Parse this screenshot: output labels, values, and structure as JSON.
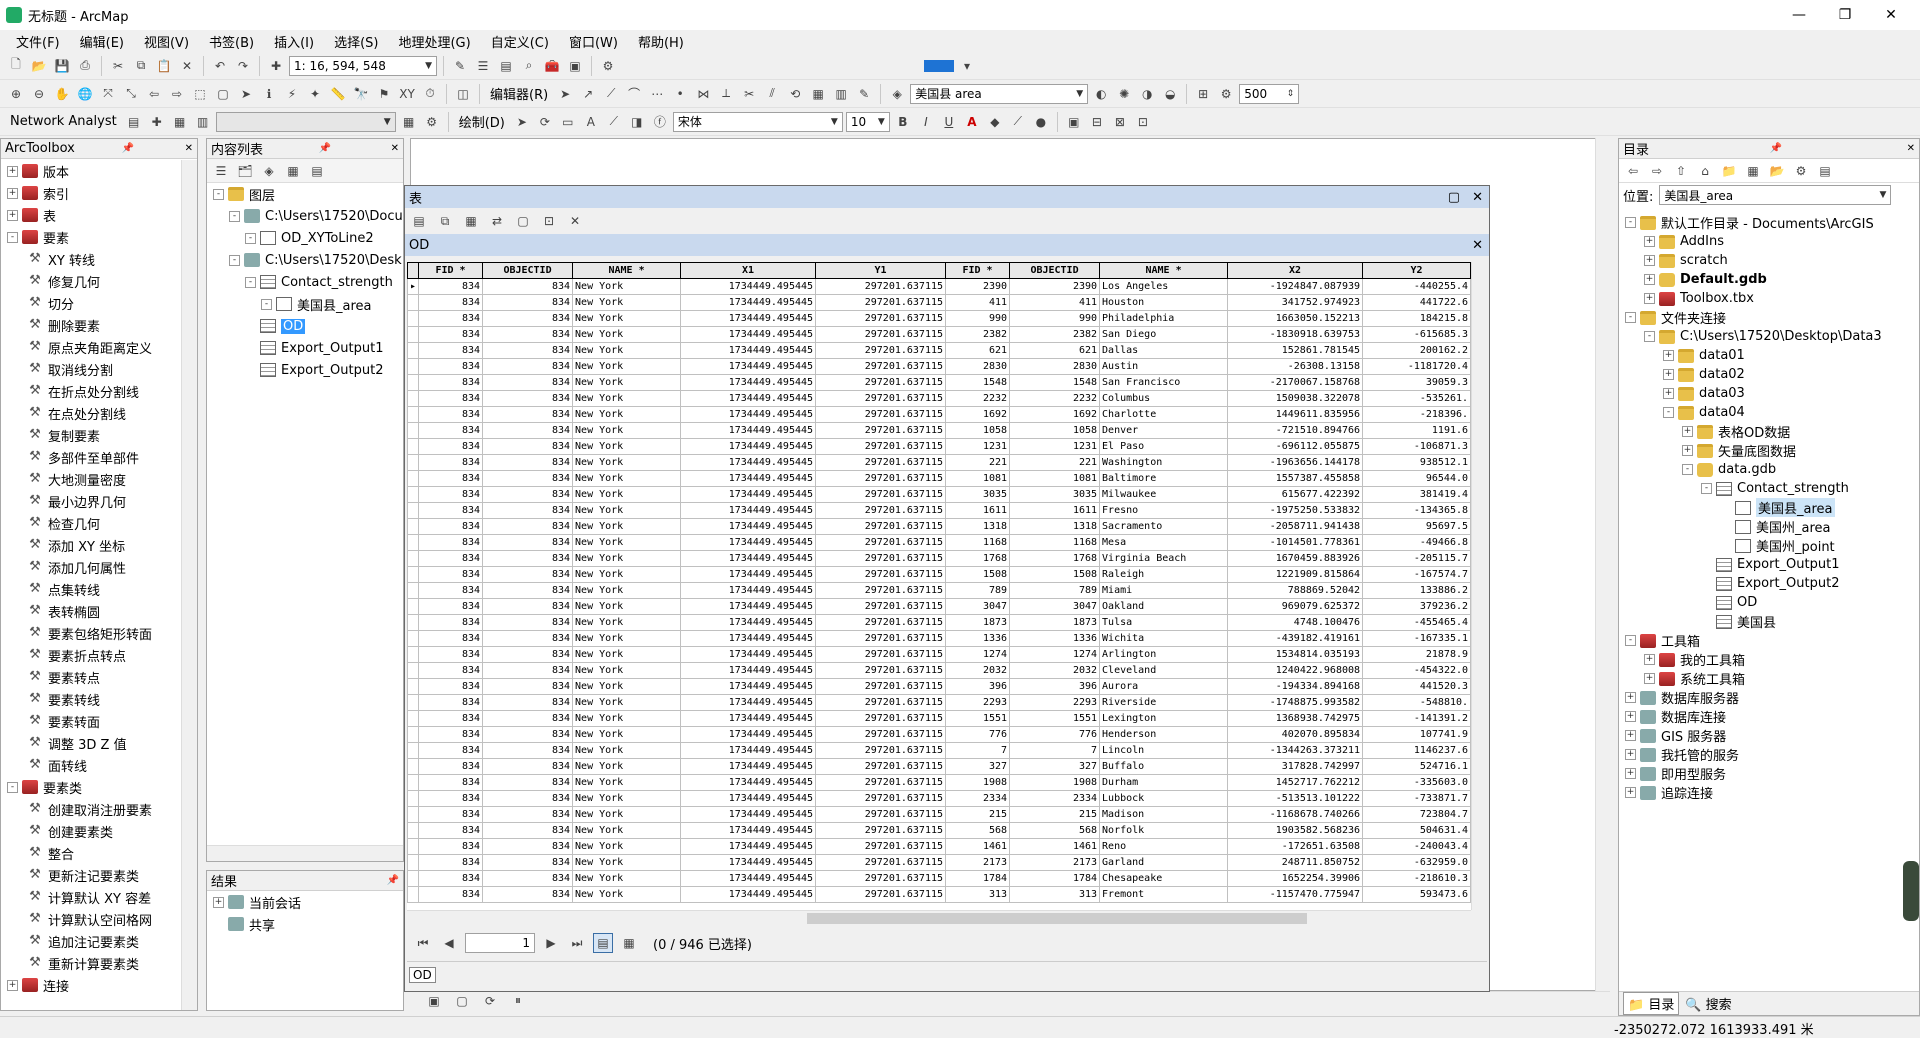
{
  "window": {
    "title": "无标题 - ArcMap"
  },
  "menu": [
    "文件(F)",
    "编辑(E)",
    "视图(V)",
    "书签(B)",
    "插入(I)",
    "选择(S)",
    "地理处理(G)",
    "自定义(C)",
    "窗口(W)",
    "帮助(H)"
  ],
  "toolbar": {
    "scale": "1: 16, 594, 548",
    "layer_select": "美国县 area",
    "editor_label": "编辑器(R)",
    "number_value": "500",
    "network_analyst": "Network Analyst",
    "draw_label": "绘制(D)",
    "font_name": "宋体",
    "font_size": "10",
    "bold": "B",
    "italic": "I",
    "underline": "U",
    "font_color": "A"
  },
  "arctoolbox": {
    "title": "ArcToolbox",
    "items": [
      {
        "label": "版本",
        "kind": "box",
        "expanded": false,
        "level": 0
      },
      {
        "label": "索引",
        "kind": "box",
        "expanded": false,
        "level": 0
      },
      {
        "label": "表",
        "kind": "box",
        "expanded": false,
        "level": 0
      },
      {
        "label": "要素",
        "kind": "box",
        "expanded": true,
        "level": 0
      },
      {
        "label": "XY 转线",
        "kind": "tool",
        "level": 1
      },
      {
        "label": "修复几何",
        "kind": "tool",
        "level": 1
      },
      {
        "label": "切分",
        "kind": "tool",
        "level": 1
      },
      {
        "label": "删除要素",
        "kind": "tool",
        "level": 1
      },
      {
        "label": "原点夹角距离定义",
        "kind": "tool",
        "level": 1
      },
      {
        "label": "取消线分割",
        "kind": "tool",
        "level": 1
      },
      {
        "label": "在折点处分割线",
        "kind": "tool",
        "level": 1
      },
      {
        "label": "在点处分割线",
        "kind": "tool",
        "level": 1
      },
      {
        "label": "复制要素",
        "kind": "tool",
        "level": 1
      },
      {
        "label": "多部件至单部件",
        "kind": "tool",
        "level": 1
      },
      {
        "label": "大地测量密度",
        "kind": "tool",
        "level": 1
      },
      {
        "label": "最小边界几何",
        "kind": "tool",
        "level": 1
      },
      {
        "label": "检查几何",
        "kind": "tool",
        "level": 1
      },
      {
        "label": "添加 XY 坐标",
        "kind": "tool",
        "level": 1
      },
      {
        "label": "添加几何属性",
        "kind": "tool",
        "level": 1
      },
      {
        "label": "点集转线",
        "kind": "tool",
        "level": 1
      },
      {
        "label": "表转椭圆",
        "kind": "tool",
        "level": 1
      },
      {
        "label": "要素包络矩形转面",
        "kind": "tool",
        "level": 1
      },
      {
        "label": "要素折点转点",
        "kind": "tool",
        "level": 1
      },
      {
        "label": "要素转点",
        "kind": "tool",
        "level": 1
      },
      {
        "label": "要素转线",
        "kind": "tool",
        "level": 1
      },
      {
        "label": "要素转面",
        "kind": "tool",
        "level": 1
      },
      {
        "label": "调整 3D Z 值",
        "kind": "tool",
        "level": 1
      },
      {
        "label": "面转线",
        "kind": "tool",
        "level": 1
      },
      {
        "label": "要素类",
        "kind": "box",
        "expanded": true,
        "level": 0
      },
      {
        "label": "创建取消注册要素",
        "kind": "tool",
        "level": 1
      },
      {
        "label": "创建要素类",
        "kind": "tool",
        "level": 1
      },
      {
        "label": "整合",
        "kind": "tool",
        "level": 1
      },
      {
        "label": "更新注记要素类",
        "kind": "tool",
        "level": 1
      },
      {
        "label": "计算默认 XY 容差",
        "kind": "tool",
        "level": 1
      },
      {
        "label": "计算默认空间格网",
        "kind": "tool",
        "level": 1
      },
      {
        "label": "追加注记要素类",
        "kind": "tool",
        "level": 1
      },
      {
        "label": "重新计算要素类",
        "kind": "tool",
        "level": 1
      },
      {
        "label": "连接",
        "kind": "box",
        "expanded": false,
        "level": 0
      }
    ]
  },
  "toc": {
    "title": "内容列表",
    "layers_label": "图层",
    "items": [
      {
        "label": "C:\\Users\\17520\\Docu",
        "kind": "folder",
        "level": 1,
        "exp": "-"
      },
      {
        "label": "OD_XYToLine2",
        "kind": "check",
        "level": 2,
        "exp": "-"
      },
      {
        "label": "C:\\Users\\17520\\Desk",
        "kind": "folder",
        "level": 1,
        "exp": "-"
      },
      {
        "label": "Contact_strength",
        "kind": "dataset",
        "level": 2,
        "exp": "-"
      },
      {
        "label": "美国县_area",
        "kind": "check",
        "level": 3,
        "exp": "-"
      },
      {
        "label": "OD",
        "kind": "table",
        "level": 2,
        "selected": true
      },
      {
        "label": "Export_Output1",
        "kind": "table",
        "level": 2
      },
      {
        "label": "Export_Output2",
        "kind": "table",
        "level": 2
      }
    ]
  },
  "results": {
    "title": "结果",
    "items": [
      "当前会话",
      "共享"
    ]
  },
  "table_window": {
    "title": "表",
    "tab_name": "OD",
    "columns": [
      "FID *",
      "OBJECTID",
      "NAME *",
      "X1",
      "Y1",
      "FID *",
      "OBJECTID",
      "NAME *",
      "X2",
      "Y2"
    ],
    "rows": [
      [
        "834",
        "834",
        "New York",
        "1734449.495445",
        "297201.637115",
        "2390",
        "2390",
        "Los Angeles",
        "-1924847.087939",
        "-440255.4"
      ],
      [
        "834",
        "834",
        "New York",
        "1734449.495445",
        "297201.637115",
        "411",
        "411",
        "Houston",
        "341752.974923",
        "441722.6"
      ],
      [
        "834",
        "834",
        "New York",
        "1734449.495445",
        "297201.637115",
        "990",
        "990",
        "Philadelphia",
        "1663050.152213",
        "184215.8"
      ],
      [
        "834",
        "834",
        "New York",
        "1734449.495445",
        "297201.637115",
        "2382",
        "2382",
        "San Diego",
        "-1830918.639753",
        "-615685.3"
      ],
      [
        "834",
        "834",
        "New York",
        "1734449.495445",
        "297201.637115",
        "621",
        "621",
        "Dallas",
        "152861.781545",
        "200162.2"
      ],
      [
        "834",
        "834",
        "New York",
        "1734449.495445",
        "297201.637115",
        "2830",
        "2830",
        "Austin",
        "-26308.13158",
        "-1181720.4"
      ],
      [
        "834",
        "834",
        "New York",
        "1734449.495445",
        "297201.637115",
        "1548",
        "1548",
        "San Francisco",
        "-2170067.158768",
        "39059.3"
      ],
      [
        "834",
        "834",
        "New York",
        "1734449.495445",
        "297201.637115",
        "2232",
        "2232",
        "Columbus",
        "1509038.322078",
        "-535261."
      ],
      [
        "834",
        "834",
        "New York",
        "1734449.495445",
        "297201.637115",
        "1692",
        "1692",
        "Charlotte",
        "1449611.835956",
        "-218396."
      ],
      [
        "834",
        "834",
        "New York",
        "1734449.495445",
        "297201.637115",
        "1058",
        "1058",
        "Denver",
        "-721510.894766",
        "1191.6"
      ],
      [
        "834",
        "834",
        "New York",
        "1734449.495445",
        "297201.637115",
        "1231",
        "1231",
        "El Paso",
        "-696112.055875",
        "-106871.3"
      ],
      [
        "834",
        "834",
        "New York",
        "1734449.495445",
        "297201.637115",
        "221",
        "221",
        "Washington",
        "-1963656.144178",
        "938512.1"
      ],
      [
        "834",
        "834",
        "New York",
        "1734449.495445",
        "297201.637115",
        "1081",
        "1081",
        "Baltimore",
        "1557387.455858",
        "96544.0"
      ],
      [
        "834",
        "834",
        "New York",
        "1734449.495445",
        "297201.637115",
        "3035",
        "3035",
        "Milwaukee",
        "615677.422392",
        "381419.4"
      ],
      [
        "834",
        "834",
        "New York",
        "1734449.495445",
        "297201.637115",
        "1611",
        "1611",
        "Fresno",
        "-1975250.533832",
        "-134365.8"
      ],
      [
        "834",
        "834",
        "New York",
        "1734449.495445",
        "297201.637115",
        "1318",
        "1318",
        "Sacramento",
        "-2058711.941438",
        "95697.5"
      ],
      [
        "834",
        "834",
        "New York",
        "1734449.495445",
        "297201.637115",
        "1168",
        "1168",
        "Mesa",
        "-1014501.778361",
        "-49466.8"
      ],
      [
        "834",
        "834",
        "New York",
        "1734449.495445",
        "297201.637115",
        "1768",
        "1768",
        "Virginia Beach",
        "1670459.883926",
        "-205115.7"
      ],
      [
        "834",
        "834",
        "New York",
        "1734449.495445",
        "297201.637115",
        "1508",
        "1508",
        "Raleigh",
        "1221909.815864",
        "-167574.7"
      ],
      [
        "834",
        "834",
        "New York",
        "1734449.495445",
        "297201.637115",
        "789",
        "789",
        "Miami",
        "788869.52042",
        "133886.2"
      ],
      [
        "834",
        "834",
        "New York",
        "1734449.495445",
        "297201.637115",
        "3047",
        "3047",
        "Oakland",
        "969079.625372",
        "379236.2"
      ],
      [
        "834",
        "834",
        "New York",
        "1734449.495445",
        "297201.637115",
        "1873",
        "1873",
        "Tulsa",
        "4748.100476",
        "-455465.4"
      ],
      [
        "834",
        "834",
        "New York",
        "1734449.495445",
        "297201.637115",
        "1336",
        "1336",
        "Wichita",
        "-439182.419161",
        "-167335.1"
      ],
      [
        "834",
        "834",
        "New York",
        "1734449.495445",
        "297201.637115",
        "1274",
        "1274",
        "Arlington",
        "1534814.035193",
        "21878.9"
      ],
      [
        "834",
        "834",
        "New York",
        "1734449.495445",
        "297201.637115",
        "2032",
        "2032",
        "Cleveland",
        "1240422.968008",
        "-454322.0"
      ],
      [
        "834",
        "834",
        "New York",
        "1734449.495445",
        "297201.637115",
        "396",
        "396",
        "Aurora",
        "-194334.894168",
        "441520.3"
      ],
      [
        "834",
        "834",
        "New York",
        "1734449.495445",
        "297201.637115",
        "2293",
        "2293",
        "Riverside",
        "-1748875.993582",
        "-548810."
      ],
      [
        "834",
        "834",
        "New York",
        "1734449.495445",
        "297201.637115",
        "1551",
        "1551",
        "Lexington",
        "1368938.742975",
        "-141391.2"
      ],
      [
        "834",
        "834",
        "New York",
        "1734449.495445",
        "297201.637115",
        "776",
        "776",
        "Henderson",
        "402070.895834",
        "107741.9"
      ],
      [
        "834",
        "834",
        "New York",
        "1734449.495445",
        "297201.637115",
        "7",
        "7",
        "Lincoln",
        "-1344263.373211",
        "1146237.6"
      ],
      [
        "834",
        "834",
        "New York",
        "1734449.495445",
        "297201.637115",
        "327",
        "327",
        "Buffalo",
        "317828.742997",
        "524716.1"
      ],
      [
        "834",
        "834",
        "New York",
        "1734449.495445",
        "297201.637115",
        "1908",
        "1908",
        "Durham",
        "1452717.762212",
        "-335603.0"
      ],
      [
        "834",
        "834",
        "New York",
        "1734449.495445",
        "297201.637115",
        "2334",
        "2334",
        "Lubbock",
        "-513513.101222",
        "-733871.7"
      ],
      [
        "834",
        "834",
        "New York",
        "1734449.495445",
        "297201.637115",
        "215",
        "215",
        "Madison",
        "-1168678.740266",
        "723804.7"
      ],
      [
        "834",
        "834",
        "New York",
        "1734449.495445",
        "297201.637115",
        "568",
        "568",
        "Norfolk",
        "1903582.568236",
        "504631.4"
      ],
      [
        "834",
        "834",
        "New York",
        "1734449.495445",
        "297201.637115",
        "1461",
        "1461",
        "Reno",
        "-172651.63508",
        "-240043.4"
      ],
      [
        "834",
        "834",
        "New York",
        "1734449.495445",
        "297201.637115",
        "2173",
        "2173",
        "Garland",
        "248711.850752",
        "-632959.0"
      ],
      [
        "834",
        "834",
        "New York",
        "1734449.495445",
        "297201.637115",
        "1784",
        "1784",
        "Chesapeake",
        "1652254.39906",
        "-218610.3"
      ],
      [
        "834",
        "834",
        "New York",
        "1734449.495445",
        "297201.637115",
        "313",
        "313",
        "Fremont",
        "-1157470.775947",
        "593473.6"
      ]
    ],
    "record_number": "1",
    "selection_status": "(0 / 946 已选择)",
    "bottom_tab": "OD"
  },
  "catalog": {
    "title": "目录",
    "location_label": "位置:",
    "location_value": "美国县_area",
    "items": [
      {
        "label": "默认工作目录 - Documents\\ArcGIS",
        "kind": "folder",
        "level": 0,
        "exp": "-"
      },
      {
        "label": "AddIns",
        "kind": "folder",
        "level": 1,
        "exp": "+"
      },
      {
        "label": "scratch",
        "kind": "folder",
        "level": 1,
        "exp": "+"
      },
      {
        "label": "Default.gdb",
        "kind": "db",
        "level": 1,
        "exp": "+",
        "bold": true
      },
      {
        "label": "Toolbox.tbx",
        "kind": "red",
        "level": 1,
        "exp": "+"
      },
      {
        "label": "文件夹连接",
        "kind": "folder",
        "level": 0,
        "exp": "-"
      },
      {
        "label": "C:\\Users\\17520\\Desktop\\Data3",
        "kind": "folder",
        "level": 1,
        "exp": "-"
      },
      {
        "label": "data01",
        "kind": "folder",
        "level": 2,
        "exp": "+"
      },
      {
        "label": "data02",
        "kind": "folder",
        "level": 2,
        "exp": "+"
      },
      {
        "label": "data03",
        "kind": "folder",
        "level": 2,
        "exp": "+"
      },
      {
        "label": "data04",
        "kind": "folder",
        "level": 2,
        "exp": "-"
      },
      {
        "label": "表格OD数据",
        "kind": "folder",
        "level": 3,
        "exp": "+"
      },
      {
        "label": "矢量底图数据",
        "kind": "folder",
        "level": 3,
        "exp": "+"
      },
      {
        "label": "data.gdb",
        "kind": "db",
        "level": 3,
        "exp": "-"
      },
      {
        "label": "Contact_strength",
        "kind": "dataset",
        "level": 4,
        "exp": "-"
      },
      {
        "label": "美国县_area",
        "kind": "fc",
        "level": 5,
        "selected": true
      },
      {
        "label": "美国州_area",
        "kind": "fc",
        "level": 5
      },
      {
        "label": "美国州_point",
        "kind": "fc",
        "level": 5
      },
      {
        "label": "Export_Output1",
        "kind": "table",
        "level": 4
      },
      {
        "label": "Export_Output2",
        "kind": "table",
        "level": 4
      },
      {
        "label": "OD",
        "kind": "table",
        "level": 4
      },
      {
        "label": "美国县",
        "kind": "table",
        "level": 4
      },
      {
        "label": "工具箱",
        "kind": "red",
        "level": 0,
        "exp": "-"
      },
      {
        "label": "我的工具箱",
        "kind": "red",
        "level": 1,
        "exp": "+"
      },
      {
        "label": "系统工具箱",
        "kind": "red",
        "level": 1,
        "exp": "+"
      },
      {
        "label": "数据库服务器",
        "kind": "cube",
        "level": 0,
        "exp": "+"
      },
      {
        "label": "数据库连接",
        "kind": "cube",
        "level": 0,
        "exp": "+"
      },
      {
        "label": "GIS 服务器",
        "kind": "cube",
        "level": 0,
        "exp": "+"
      },
      {
        "label": "我托管的服务",
        "kind": "cube",
        "level": 0,
        "exp": "+"
      },
      {
        "label": "即用型服务",
        "kind": "cube",
        "level": 0,
        "exp": "+"
      },
      {
        "label": "追踪连接",
        "kind": "cube",
        "level": 0,
        "exp": "+"
      }
    ],
    "tab_catalog": "目录",
    "tab_search": "搜索"
  },
  "status": {
    "coords": "-2350272.072  1613933.491 米"
  }
}
